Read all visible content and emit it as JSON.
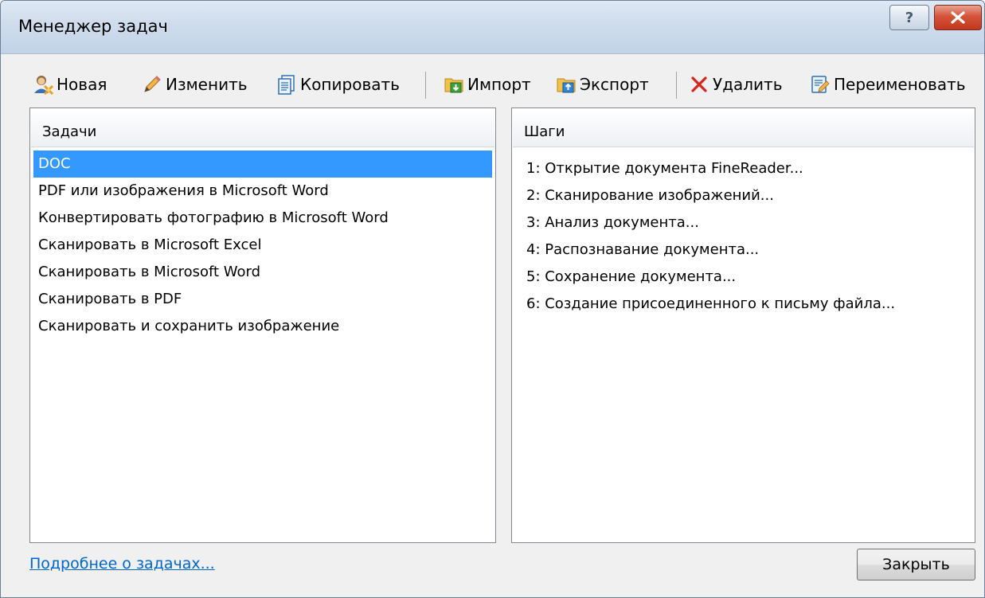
{
  "window": {
    "title": "Менеджер задач",
    "help_label": "?"
  },
  "toolbar": {
    "new_label": "Новая",
    "edit_label": "Изменить",
    "copy_label": "Копировать",
    "import_label": "Импорт",
    "export_label": "Экспорт",
    "delete_label": "Удалить",
    "rename_label": "Переименовать"
  },
  "tasks": {
    "header": "Задачи",
    "items": [
      "DOC",
      "PDF или изображения в Microsoft Word",
      "Конвертировать фотографию в Microsoft Word",
      "Сканировать в Microsoft Excel",
      "Сканировать в Microsoft Word",
      "Сканировать в PDF",
      "Сканировать и сохранить изображение"
    ],
    "selected": "DOC"
  },
  "steps": {
    "header": "Шаги",
    "items": [
      "1: Открытие документа FineReader...",
      "2: Сканирование изображений...",
      "3: Анализ документа...",
      "4: Распознавание документа...",
      "5: Сохранение документа...",
      "6: Создание присоединенного к письму файла..."
    ]
  },
  "footer": {
    "more_link": "Подробнее о задачах...",
    "close_label": "Закрыть"
  },
  "colors": {
    "selection": "#3399ff",
    "link": "#0066cc",
    "close_red": "#c1381d"
  }
}
